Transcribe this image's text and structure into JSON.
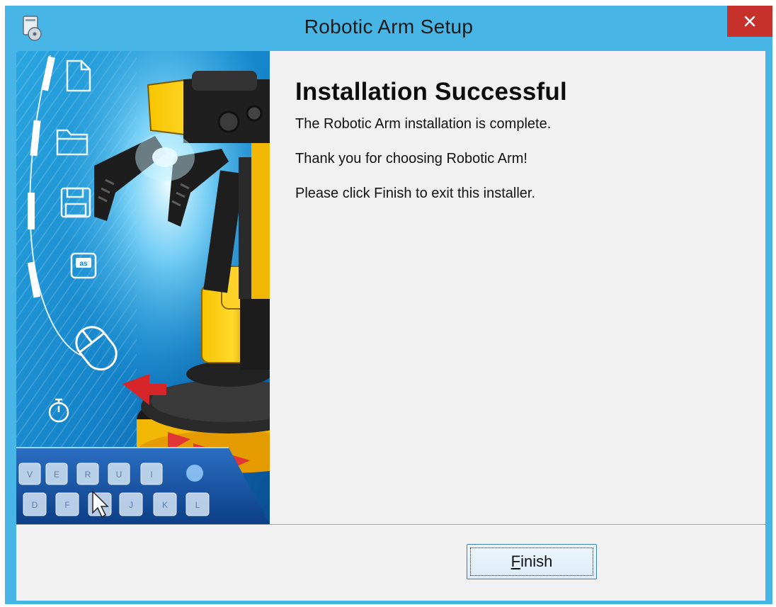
{
  "window": {
    "title": "Robotic Arm Setup",
    "icons": {
      "app": "setup-disk-icon",
      "close": "close-icon"
    },
    "accent_color": "#47b6e6",
    "close_color": "#c7312b"
  },
  "content": {
    "heading": "Installation Successful",
    "line1": "The Robotic Arm  installation is complete.",
    "line2": "Thank you for choosing Robotic Arm!",
    "line3": "Please click Finish to exit this installer."
  },
  "buttons": {
    "finish_mnemonic": "F",
    "finish_rest": "inish"
  },
  "banner": {
    "icons": [
      "document-icon",
      "folder-icon",
      "floppy-disk-icon",
      "as-chip-icon",
      "mouse-icon",
      "stopwatch-icon",
      "keyboard-icon",
      "robotic-arm-illustration"
    ],
    "keyboard_keys_row1": [
      "V",
      "E",
      "R",
      "U",
      "I"
    ],
    "keyboard_keys_row2": [
      "D",
      "F",
      "J",
      "K",
      "L"
    ]
  }
}
